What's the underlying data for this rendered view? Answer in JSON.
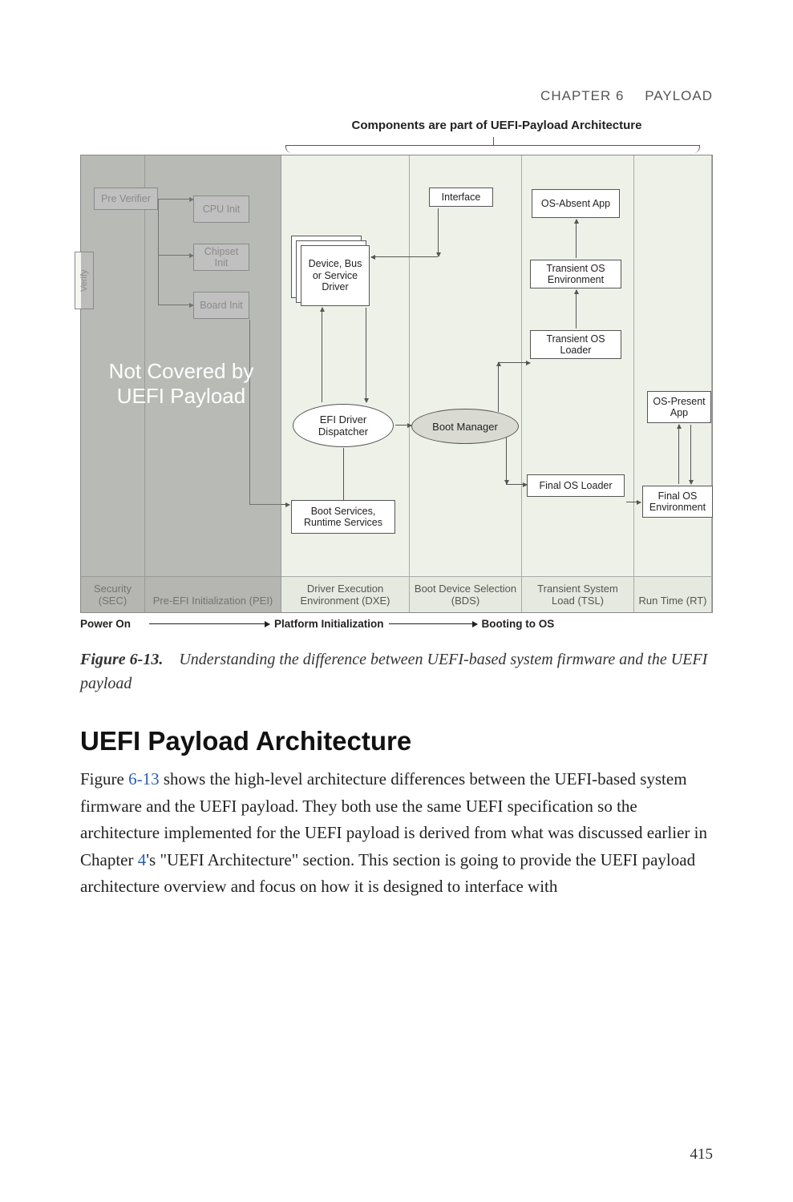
{
  "header": {
    "chapter": "CHAPTER 6",
    "title": "PAYLOAD"
  },
  "figure": {
    "topTitle": "Components are part of UEFI-Payload Architecture",
    "notCovered": "Not Covered by UEFI Payload",
    "phases": {
      "sec": "Security (SEC)",
      "pei": "Pre-EFI Initialization (PEI)",
      "dxe": "Driver Execution Environment (DXE)",
      "bds": "Boot Device Selection (BDS)",
      "tsl": "Transient System Load (TSL)",
      "rt": "Run Time (RT)"
    },
    "boxes": {
      "preVerifier": "Pre Verifier",
      "verify": "Verify",
      "cpuInit": "CPU Init",
      "chipsetInit": "Chipset Init",
      "boardInit": "Board Init",
      "deviceDriver": "Device, Bus or Service Driver",
      "interface": "Interface",
      "efiDispatcher": "EFI Driver Dispatcher",
      "bootSvcs": "Boot Services, Runtime Services",
      "bootManager": "Boot Manager",
      "osAbsentApp": "OS-Absent App",
      "transEnv": "Transient OS Environment",
      "transLoader": "Transient OS Loader",
      "finalLoader": "Final OS Loader",
      "osPresentApp": "OS-Present App",
      "finalEnv": "Final OS Environment"
    },
    "timeline": {
      "powerOn": "Power On",
      "platformInit": "Platform Initialization",
      "booting": "Booting to OS"
    },
    "captionNum": "Figure 6-13.",
    "captionText": "Understanding the difference between UEFI-based system firmware and the UEFI payload"
  },
  "section": {
    "heading": "UEFI Payload Architecture",
    "para_a": "Figure ",
    "para_link1": "6-13",
    "para_b": " shows the high-level architecture differences between the UEFI-based system firmware and the UEFI payload. They both use the same UEFI specification so the architecture implemented for the UEFI payload is derived from what was discussed earlier in Chapter ",
    "para_link2": "4",
    "para_c": "'s \"UEFI Architecture\" section. This section is going to provide the UEFI payload architecture overview and focus on how it is designed to interface with"
  },
  "pageNumber": "415"
}
